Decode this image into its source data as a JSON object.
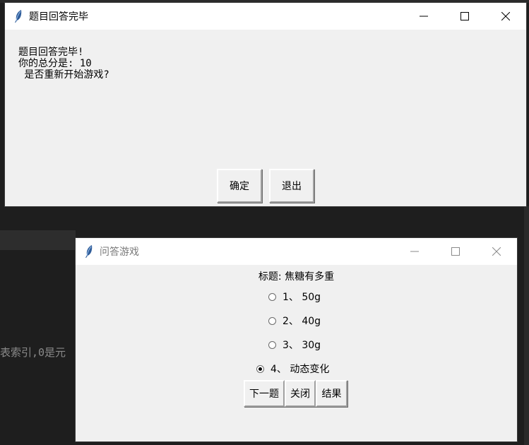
{
  "background": {
    "code_fragment": "表索引,0是元"
  },
  "result_window": {
    "title": "题目回答完毕",
    "message_lines": [
      "题目回答完毕!",
      "你的总分是: 10",
      " 是否重新开始游戏?"
    ],
    "ok_label": "确定",
    "exit_label": "退出",
    "icon": "feather-icon"
  },
  "quiz_window": {
    "title": "问答游戏",
    "question_title": "标题: 焦糖有多重",
    "options": [
      {
        "label": "1、 50g",
        "checked": false
      },
      {
        "label": "2、 40g",
        "checked": false
      },
      {
        "label": "3、 30g",
        "checked": false
      },
      {
        "label": "4、 动态变化",
        "checked": true
      }
    ],
    "buttons": {
      "next": "下一题",
      "close": "关闭",
      "result": "结果"
    },
    "icon": "feather-icon"
  },
  "colors": {
    "window_bg": "#f0f0f0",
    "titlebar_bg": "#ffffff",
    "desktop_bg": "#1e1e1e"
  }
}
